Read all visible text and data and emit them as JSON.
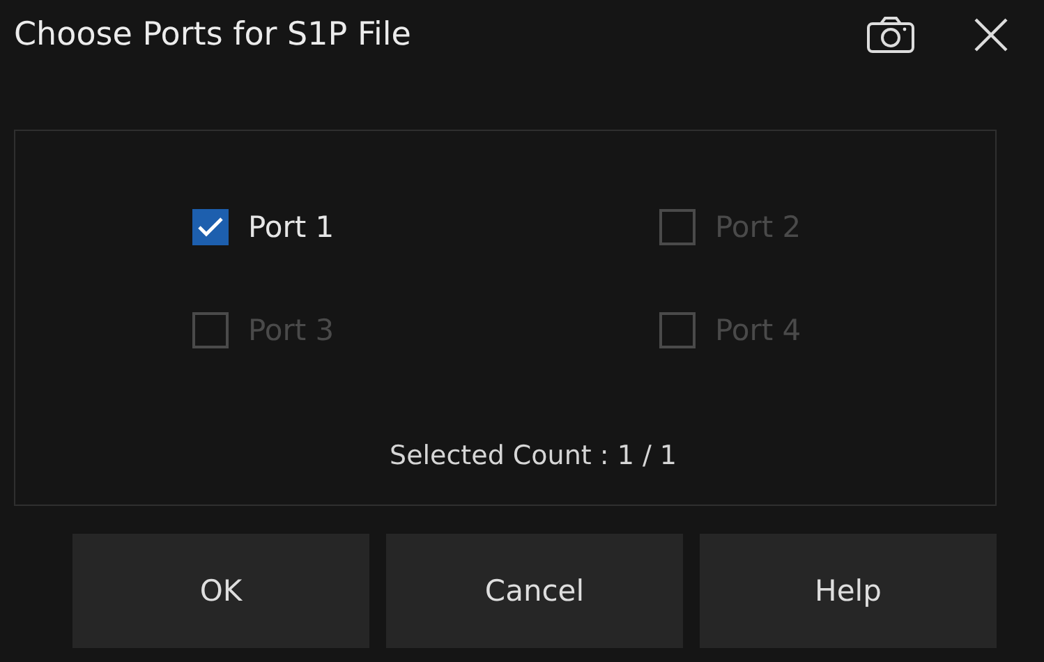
{
  "window": {
    "title": "Choose Ports for S1P File"
  },
  "ports": [
    {
      "label": "Port 1",
      "checked": true,
      "disabled": false
    },
    {
      "label": "Port 2",
      "checked": false,
      "disabled": true
    },
    {
      "label": "Port 3",
      "checked": false,
      "disabled": true
    },
    {
      "label": "Port 4",
      "checked": false,
      "disabled": true
    }
  ],
  "selected_count": "Selected Count :  1 / 1",
  "buttons": [
    "OK",
    "Cancel",
    "Help"
  ]
}
